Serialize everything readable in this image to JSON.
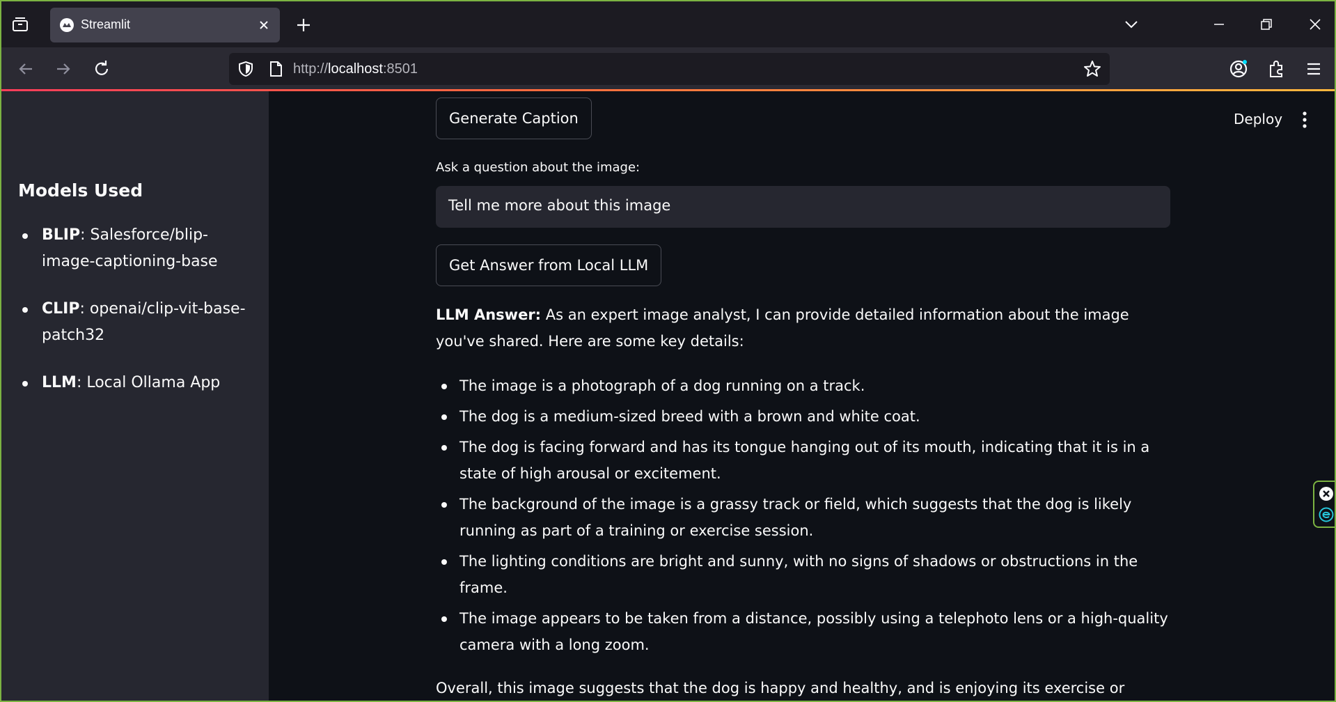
{
  "browser": {
    "tab_title": "Streamlit",
    "url_prefix": "http://",
    "url_host": "localhost",
    "url_port": ":8501",
    "accent": "#7cb342"
  },
  "sidebar": {
    "title": "Models Used",
    "items": [
      {
        "name": "BLIP",
        "sep": ":",
        "value": " Salesforce/blip-image-captioning-base"
      },
      {
        "name": "CLIP",
        "sep": ":",
        "value": " openai/clip-vit-base-patch32"
      },
      {
        "name": "LLM",
        "sep": ":",
        "value": " Local Ollama App"
      }
    ]
  },
  "header": {
    "deploy_label": "Deploy"
  },
  "main": {
    "generate_caption_label": "Generate Caption",
    "question_label": "Ask a question about the image:",
    "question_value": "Tell me more about this image",
    "get_answer_label": "Get Answer from Local LLM",
    "answer_heading": "LLM Answer:",
    "answer_intro": " As an expert image analyst, I can provide detailed information about the image you've shared. Here are some key details:",
    "answer_points": [
      "The image is a photograph of a dog running on a track.",
      "The dog is a medium-sized breed with a brown and white coat.",
      "The dog is facing forward and has its tongue hanging out of its mouth, indicating that it is in a state of high arousal or excitement.",
      "The background of the image is a grassy track or field, which suggests that the dog is likely running as part of a training or exercise session.",
      "The lighting conditions are bright and sunny, with no signs of shadows or obstructions in the frame.",
      "The image appears to be taken from a distance, possibly using a telephoto lens or a high-quality camera with a long zoom."
    ],
    "answer_overall": "Overall, this image suggests that the dog is happy and healthy, and is enjoying its exercise or training session."
  }
}
